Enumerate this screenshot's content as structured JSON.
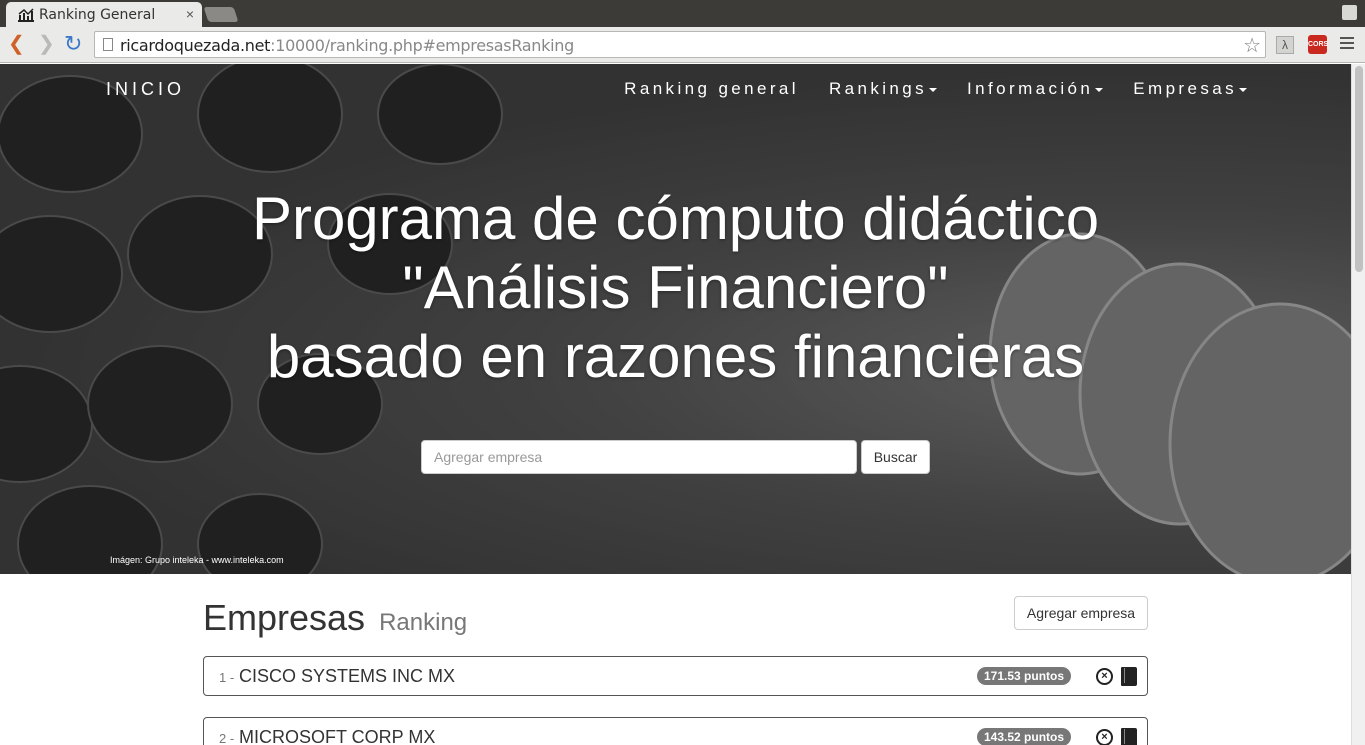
{
  "browser": {
    "tab_title": "Ranking General",
    "tab_close": "×",
    "url_host": "ricardoquezada.net",
    "url_rest": ":10000/ranking.php#empresasRanking",
    "ext_lambda": "λ",
    "ext_cors": "CORS"
  },
  "navbar": {
    "brand": "INICIO",
    "links": [
      "Ranking general",
      "Rankings",
      "Información",
      "Empresas"
    ]
  },
  "hero": {
    "title_line1": "Programa de cómputo didáctico",
    "title_line2": "\"Análisis Financiero\"",
    "title_line3": "basado en razones financieras",
    "search_placeholder": "Agregar empresa",
    "search_button": "Buscar",
    "credit": "Imágen: Grupo inteleka - www.inteleka.com"
  },
  "section": {
    "title": "Empresas",
    "subtitle": "Ranking",
    "add_button": "Agregar empresa"
  },
  "ranking": [
    {
      "num": "1 -",
      "name": "CISCO SYSTEMS INC MX",
      "points": "171.53 puntos"
    },
    {
      "num": "2 -",
      "name": "MICROSOFT CORP MX",
      "points": "143.52 puntos"
    }
  ]
}
